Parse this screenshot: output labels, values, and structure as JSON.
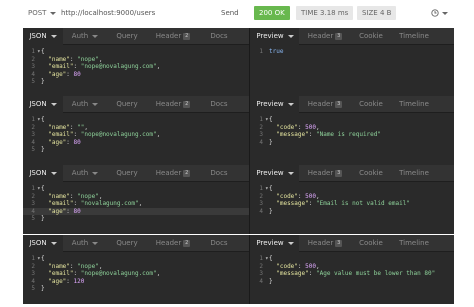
{
  "topbar": {
    "method": "POST",
    "url": "http://localhost:9000/users",
    "send_label": "Send",
    "status": "200 OK",
    "time": "TIME 3.18 ms",
    "size": "SIZE 4 B"
  },
  "colors": {
    "status_green": "#68b84e",
    "panel_bg": "#2a2a2a"
  },
  "tabs": {
    "left": {
      "json": "JSON",
      "auth": "Auth",
      "query": "Query",
      "header": "Header",
      "header_badge": "2",
      "docs": "Docs"
    },
    "right_first": {
      "preview": "Preview",
      "header": "Header",
      "header_badge": "3",
      "cookie": "Cookie",
      "timeline": "Timeline"
    },
    "right": {
      "preview": "Preview",
      "header": "Header",
      "header_badge": "3",
      "cookie": "Cookie",
      "timeline": "Timeline"
    }
  },
  "panels": [
    {
      "request": [
        {
          "ln": "1",
          "fold": "▾",
          "parts": [
            [
              "{",
              "txt"
            ]
          ]
        },
        {
          "ln": "2",
          "fold": "",
          "parts": [
            [
              "  ",
              "txt"
            ],
            [
              "\"name\"",
              "k"
            ],
            [
              ": ",
              "txt"
            ],
            [
              "\"nope\"",
              "s"
            ],
            [
              ",",
              "txt"
            ]
          ]
        },
        {
          "ln": "3",
          "fold": "",
          "parts": [
            [
              "  ",
              "txt"
            ],
            [
              "\"email\"",
              "k"
            ],
            [
              ": ",
              "txt"
            ],
            [
              "\"nope@novalagung.com\"",
              "s"
            ],
            [
              ",",
              "txt"
            ]
          ]
        },
        {
          "ln": "4",
          "fold": "",
          "parts": [
            [
              "  ",
              "txt"
            ],
            [
              "\"age\"",
              "k"
            ],
            [
              ": ",
              "txt"
            ],
            [
              "80",
              "n"
            ]
          ]
        },
        {
          "ln": "5",
          "fold": "",
          "parts": [
            [
              "}",
              "txt"
            ]
          ]
        }
      ],
      "response": [
        {
          "ln": "1",
          "fold": "",
          "parts": [
            [
              "true",
              "b"
            ]
          ]
        }
      ]
    },
    {
      "request": [
        {
          "ln": "1",
          "fold": "▾",
          "parts": [
            [
              "{",
              "txt"
            ]
          ]
        },
        {
          "ln": "2",
          "fold": "",
          "parts": [
            [
              "  ",
              "txt"
            ],
            [
              "\"name\"",
              "k"
            ],
            [
              ": ",
              "txt"
            ],
            [
              "\"\"",
              "s"
            ],
            [
              ",",
              "txt"
            ]
          ]
        },
        {
          "ln": "3",
          "fold": "",
          "parts": [
            [
              "  ",
              "txt"
            ],
            [
              "\"email\"",
              "k"
            ],
            [
              ": ",
              "txt"
            ],
            [
              "\"nope@novalagung.com\"",
              "s"
            ],
            [
              ",",
              "txt"
            ]
          ]
        },
        {
          "ln": "4",
          "fold": "",
          "parts": [
            [
              "  ",
              "txt"
            ],
            [
              "\"age\"",
              "k"
            ],
            [
              ": ",
              "txt"
            ],
            [
              "80",
              "n"
            ]
          ]
        },
        {
          "ln": "5",
          "fold": "",
          "parts": [
            [
              "}",
              "txt"
            ]
          ]
        }
      ],
      "response": [
        {
          "ln": "1",
          "fold": "▾",
          "parts": [
            [
              "{",
              "txt"
            ]
          ]
        },
        {
          "ln": "2",
          "fold": "",
          "parts": [
            [
              "  ",
              "txt"
            ],
            [
              "\"code\"",
              "k"
            ],
            [
              ": ",
              "txt"
            ],
            [
              "500",
              "n"
            ],
            [
              ",",
              "txt"
            ]
          ]
        },
        {
          "ln": "3",
          "fold": "",
          "parts": [
            [
              "  ",
              "txt"
            ],
            [
              "\"message\"",
              "k"
            ],
            [
              ": ",
              "txt"
            ],
            [
              "\"Name is required\"",
              "s"
            ]
          ]
        },
        {
          "ln": "4",
          "fold": "",
          "parts": [
            [
              "}",
              "txt"
            ]
          ]
        }
      ]
    },
    {
      "request": [
        {
          "ln": "1",
          "fold": "▾",
          "parts": [
            [
              "{",
              "txt"
            ]
          ]
        },
        {
          "ln": "2",
          "fold": "",
          "parts": [
            [
              "  ",
              "txt"
            ],
            [
              "\"name\"",
              "k"
            ],
            [
              ": ",
              "txt"
            ],
            [
              "\"nope\"",
              "s"
            ],
            [
              ",",
              "txt"
            ]
          ]
        },
        {
          "ln": "3",
          "fold": "",
          "parts": [
            [
              "  ",
              "txt"
            ],
            [
              "\"email\"",
              "k"
            ],
            [
              ": ",
              "txt"
            ],
            [
              "\"novalagung.com\"",
              "s"
            ],
            [
              ",",
              "txt"
            ]
          ]
        },
        {
          "ln": "4",
          "fold": "",
          "parts": [
            [
              "  ",
              "txt"
            ],
            [
              "\"age\"",
              "k"
            ],
            [
              ": ",
              "txt"
            ],
            [
              "80",
              "n"
            ]
          ]
        },
        {
          "ln": "5",
          "fold": "",
          "parts": [
            [
              "}",
              "txt"
            ]
          ]
        }
      ],
      "response": [
        {
          "ln": "1",
          "fold": "▾",
          "parts": [
            [
              "{",
              "txt"
            ]
          ]
        },
        {
          "ln": "2",
          "fold": "",
          "parts": [
            [
              "  ",
              "txt"
            ],
            [
              "\"code\"",
              "k"
            ],
            [
              ": ",
              "txt"
            ],
            [
              "500",
              "n"
            ],
            [
              ",",
              "txt"
            ]
          ]
        },
        {
          "ln": "3",
          "fold": "",
          "parts": [
            [
              "  ",
              "txt"
            ],
            [
              "\"message\"",
              "k"
            ],
            [
              ": ",
              "txt"
            ],
            [
              "\"Email is not valid email\"",
              "s"
            ]
          ]
        },
        {
          "ln": "4",
          "fold": "",
          "parts": [
            [
              "}",
              "txt"
            ]
          ]
        }
      ]
    },
    {
      "request": [
        {
          "ln": "1",
          "fold": "▾",
          "parts": [
            [
              "{",
              "txt"
            ]
          ]
        },
        {
          "ln": "2",
          "fold": "",
          "parts": [
            [
              "  ",
              "txt"
            ],
            [
              "\"name\"",
              "k"
            ],
            [
              ": ",
              "txt"
            ],
            [
              "\"nope\"",
              "s"
            ],
            [
              ",",
              "txt"
            ]
          ]
        },
        {
          "ln": "3",
          "fold": "",
          "parts": [
            [
              "  ",
              "txt"
            ],
            [
              "\"email\"",
              "k"
            ],
            [
              ": ",
              "txt"
            ],
            [
              "\"nope@novalagung.com\"",
              "s"
            ],
            [
              ",",
              "txt"
            ]
          ]
        },
        {
          "ln": "4",
          "fold": "",
          "parts": [
            [
              "  ",
              "txt"
            ],
            [
              "\"age\"",
              "k"
            ],
            [
              ": ",
              "txt"
            ],
            [
              "120",
              "n"
            ]
          ]
        },
        {
          "ln": "5",
          "fold": "",
          "parts": [
            [
              "}",
              "txt"
            ]
          ]
        }
      ],
      "response": [
        {
          "ln": "1",
          "fold": "▾",
          "parts": [
            [
              "{",
              "txt"
            ]
          ]
        },
        {
          "ln": "2",
          "fold": "",
          "parts": [
            [
              "  ",
              "txt"
            ],
            [
              "\"code\"",
              "k"
            ],
            [
              ": ",
              "txt"
            ],
            [
              "500",
              "n"
            ],
            [
              ",",
              "txt"
            ]
          ]
        },
        {
          "ln": "3",
          "fold": "",
          "parts": [
            [
              "  ",
              "txt"
            ],
            [
              "\"message\"",
              "k"
            ],
            [
              ": ",
              "txt"
            ],
            [
              "\"Age value must be lower than 80\"",
              "s"
            ]
          ]
        },
        {
          "ln": "4",
          "fold": "",
          "parts": [
            [
              "}",
              "txt"
            ]
          ]
        }
      ]
    }
  ]
}
